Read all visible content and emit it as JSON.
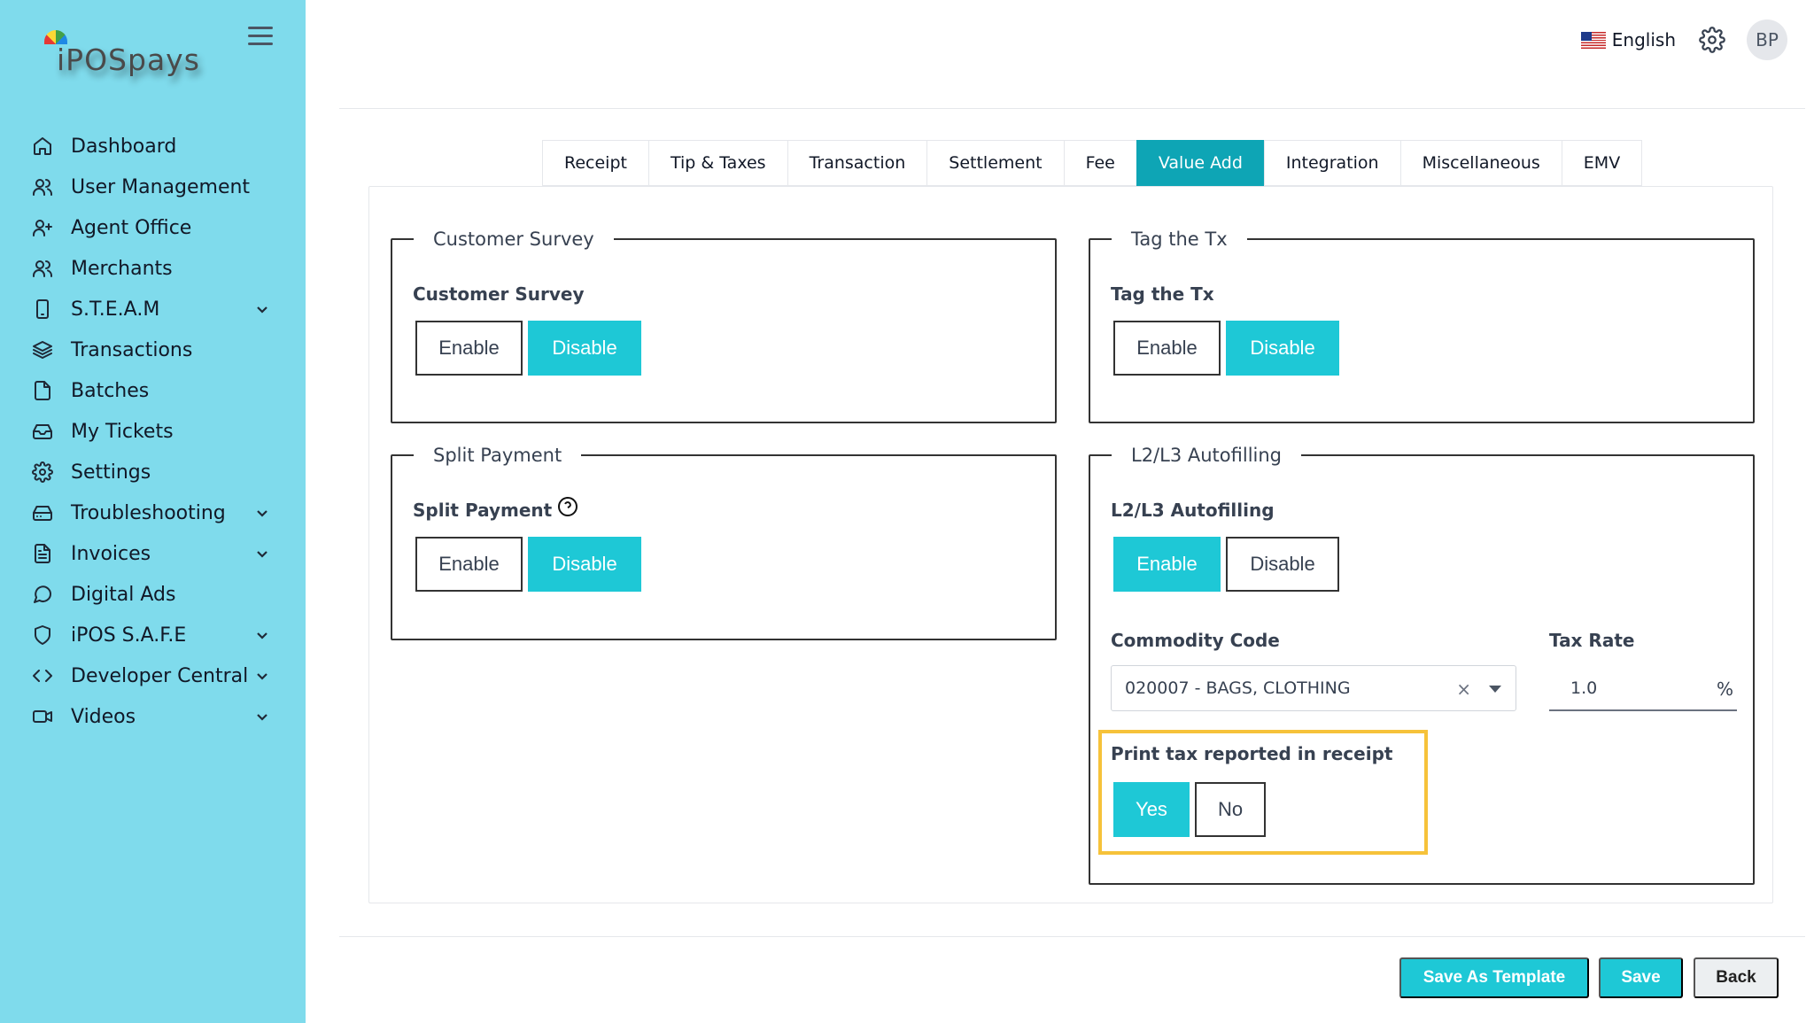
{
  "sidebar": {
    "logo_text": "iPOSpays",
    "items": [
      {
        "label": "Dashboard",
        "icon": "home-icon"
      },
      {
        "label": "User Management",
        "icon": "users-icon"
      },
      {
        "label": "Agent Office",
        "icon": "user-plus-icon"
      },
      {
        "label": "Merchants",
        "icon": "users-icon"
      },
      {
        "label": "S.T.E.A.M",
        "icon": "device-icon",
        "expandable": true
      },
      {
        "label": "Transactions",
        "icon": "layers-icon"
      },
      {
        "label": "Batches",
        "icon": "file-icon"
      },
      {
        "label": "My Tickets",
        "icon": "inbox-icon"
      },
      {
        "label": "Settings",
        "icon": "gear-icon"
      },
      {
        "label": "Troubleshooting",
        "icon": "hard-drive-icon",
        "expandable": true
      },
      {
        "label": "Invoices",
        "icon": "file-text-icon",
        "expandable": true
      },
      {
        "label": "Digital Ads",
        "icon": "message-circle-icon"
      },
      {
        "label": "iPOS S.A.F.E",
        "icon": "shield-icon",
        "expandable": true
      },
      {
        "label": "Developer Central",
        "icon": "code-icon",
        "expandable": true
      },
      {
        "label": "Videos",
        "icon": "video-icon",
        "expandable": true
      }
    ]
  },
  "header": {
    "language": "English",
    "avatar_initials": "BP"
  },
  "tabs": [
    {
      "label": "Receipt"
    },
    {
      "label": "Tip & Taxes"
    },
    {
      "label": "Transaction"
    },
    {
      "label": "Settlement"
    },
    {
      "label": "Fee"
    },
    {
      "label": "Value Add",
      "active": true
    },
    {
      "label": "Integration"
    },
    {
      "label": "Miscellaneous"
    },
    {
      "label": "EMV"
    }
  ],
  "customer_survey": {
    "legend": "Customer Survey",
    "label": "Customer Survey",
    "enable": "Enable",
    "disable": "Disable",
    "selected": "Disable"
  },
  "tag_tx": {
    "legend": "Tag the Tx",
    "label": "Tag the Tx",
    "enable": "Enable",
    "disable": "Disable",
    "selected": "Disable"
  },
  "split_payment": {
    "legend": "Split Payment",
    "label": "Split Payment",
    "enable": "Enable",
    "disable": "Disable",
    "selected": "Disable"
  },
  "l2l3": {
    "legend": "L2/L3 Autofilling",
    "label": "L2/L3 Autofilling",
    "enable": "Enable",
    "disable": "Disable",
    "selected": "Enable",
    "commodity_label": "Commodity Code",
    "commodity_value": "020007 - BAGS, CLOTHING",
    "clear_symbol": "×",
    "tax_rate_label": "Tax Rate",
    "tax_rate_value": "1.0",
    "tax_rate_unit": "%",
    "print_tax_label": "Print tax reported in receipt",
    "yes": "Yes",
    "no": "No",
    "print_tax_selected": "Yes"
  },
  "footer": {
    "save_template": "Save As Template",
    "save": "Save",
    "back": "Back"
  },
  "colors": {
    "sidebar_bg": "#7fdbec",
    "accent": "#1ec8d6",
    "active_tab": "#0ea5b5",
    "highlight": "#f6c23a"
  }
}
